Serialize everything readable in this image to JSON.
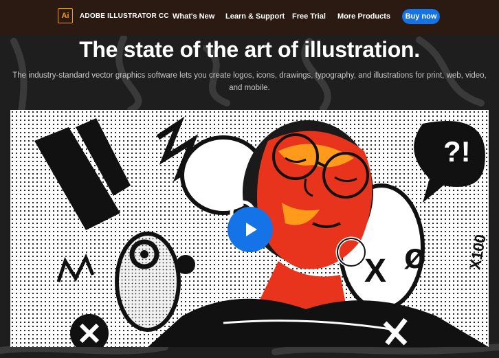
{
  "nav": {
    "logo_text": "Ai",
    "product": "ADOBE ILLUSTRATOR CC",
    "links": [
      "What's New",
      "Learn & Support",
      "Free Trial",
      "More Products"
    ],
    "buy_label": "Buy now"
  },
  "hero": {
    "title": "The state of the art of illustration.",
    "subtitle_line1": "The industry-standard vector graphics software lets you create logos, icons, drawings, typography, and illustrations for print, web, video,",
    "subtitle_line2": "and mobile."
  },
  "video": {
    "play_icon": "play-icon",
    "artwork_text": [
      "X",
      "ø",
      "X100",
      "?!"
    ]
  },
  "colors": {
    "nav_bg": "#2b1a12",
    "accent": "#1473e6",
    "logo": "#ff9a00",
    "face_red": "#e8341c",
    "face_orange": "#ff9a1a"
  }
}
